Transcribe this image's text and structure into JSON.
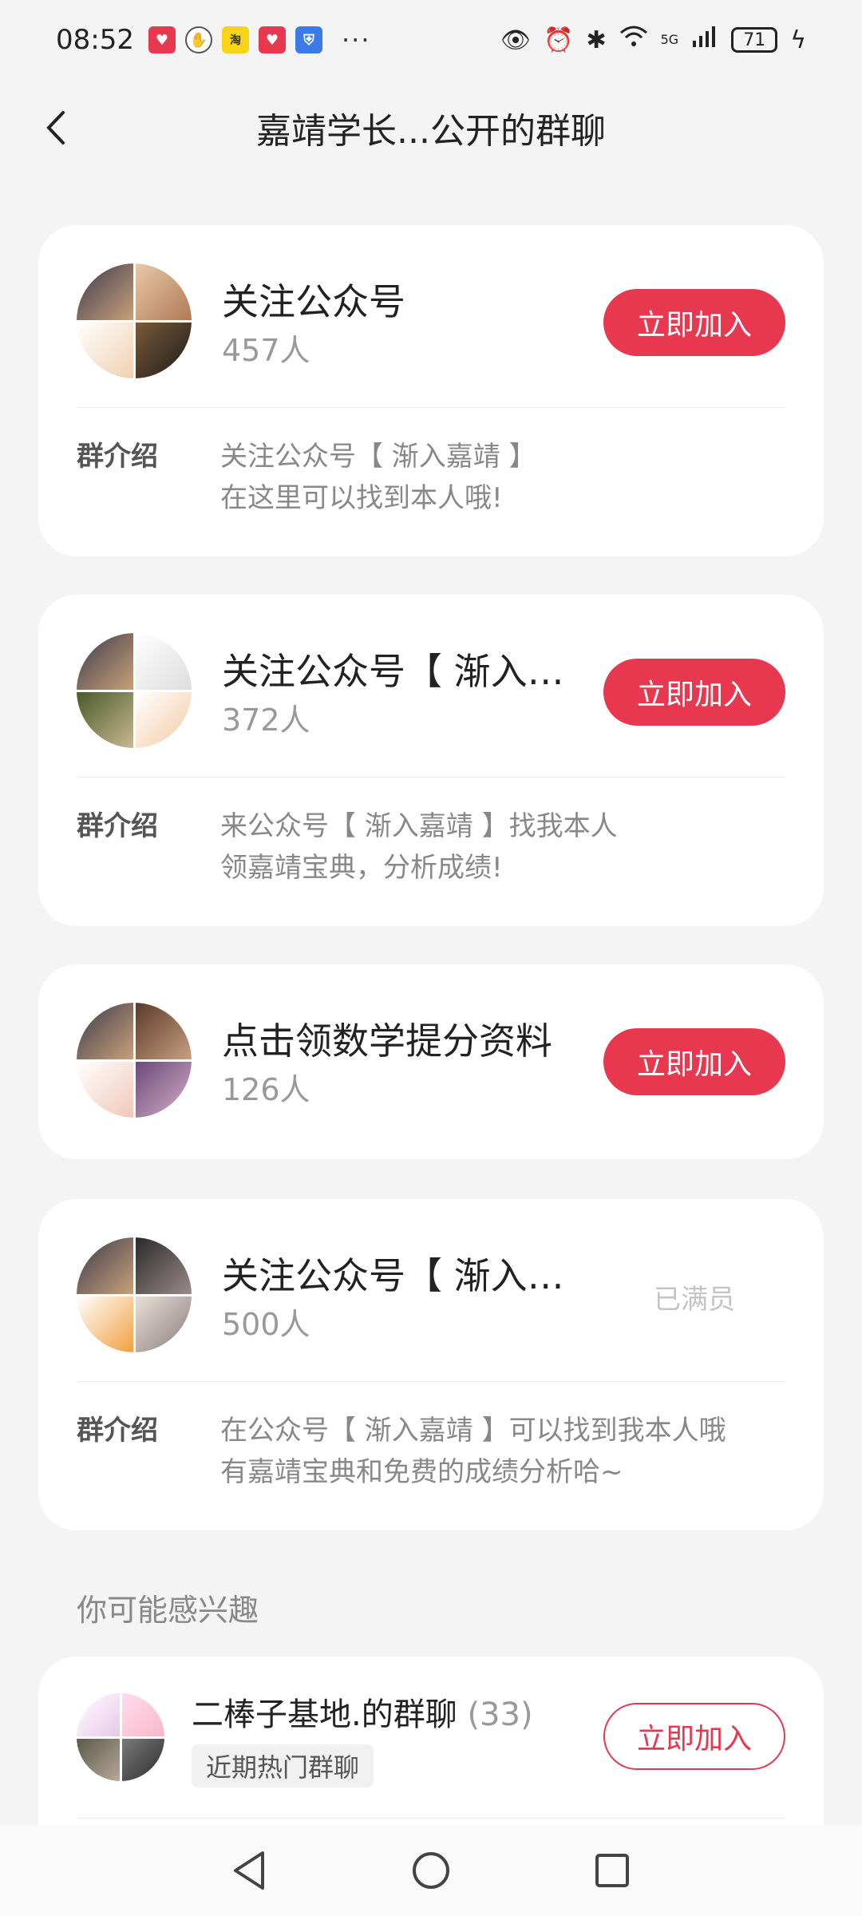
{
  "status_bar": {
    "time": "08:52",
    "notification_icons": [
      "heart-app-icon",
      "hand-app-icon",
      "taobao-app-icon",
      "heart-app-icon",
      "shield-app-icon"
    ],
    "more": "···",
    "network": "5G",
    "battery": "71"
  },
  "header": {
    "title": "嘉靖学长...公开的群聊"
  },
  "groups": [
    {
      "name": "关注公众号",
      "members": "457人",
      "action": "立即加入",
      "intro_label": "群介绍",
      "intro_line1": "关注公众号【 渐入嘉靖 】",
      "intro_line2": "在这里可以找到本人哦!"
    },
    {
      "name": "关注公众号【 渐入…",
      "members": "372人",
      "action": "立即加入",
      "intro_label": "群介绍",
      "intro_line1": "来公众号【 渐入嘉靖 】找我本人",
      "intro_line2": "领嘉靖宝典，分析成绩!"
    },
    {
      "name": "点击领数学提分资料",
      "members": "126人",
      "action": "立即加入"
    },
    {
      "name": "关注公众号【 渐入…",
      "members": "500人",
      "action": "已满员",
      "intro_label": "群介绍",
      "intro_line1": "在公众号【 渐入嘉靖 】可以找到我本人哦",
      "intro_line2": "有嘉靖宝典和免费的成绩分析哈~"
    }
  ],
  "recommend": {
    "section_title": "你可能感兴趣",
    "name": "二棒子基地.的群聊",
    "count": "(33)",
    "tag": "近期热门群聊",
    "action": "立即加入"
  },
  "colors": {
    "accent": "#e8384f",
    "background": "#f4f4f4"
  }
}
